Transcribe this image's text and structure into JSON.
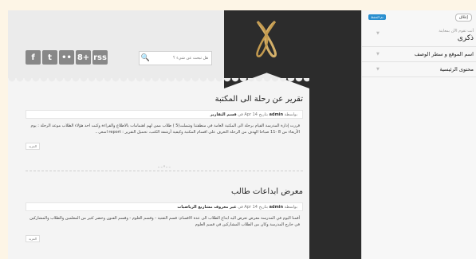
{
  "header": {
    "social_icons": [
      "f",
      "t",
      "••",
      "8+",
      "rss"
    ],
    "search_placeholder": "هل تبحث عن شيء ؟",
    "search_icon_glyph": "🔍"
  },
  "posts": [
    {
      "title": "تقرير عن رحلة الى المكتبة",
      "meta": {
        "by_label": "بواسطة",
        "author": "admin",
        "date_label": "بتاريخ 14 Apr في",
        "category": "قسم التقارير"
      },
      "excerpt": "قررت إدارة المدرسة القيام برحلة الى المكتبة العامة في منطقتنا وشملت(5 ) طلاب ممن لهم اهتمامات بالاطلاع والقراءة وكنت احد هؤلاء الطلاب موعد الرحلة : يوم الأربعاء من 8 -11 صباحا الهدف من الرحلة التعرف على اقسام المكتبة وكيفية أرشفة الكتب، تحميل التقرير : report اسعر...",
      "more_label": "المزيد"
    },
    {
      "title": "معرض ابداعات طالب",
      "meta": {
        "by_label": "بواسطة",
        "author": "admin",
        "date_label": "بتاريخ 14 Apr في",
        "category": "غير معروف مشاريع الرياضيات"
      },
      "excerpt": "أقمنا اليوم في المدرسة معرض تعرض اليه ابداع الطلاب الى عدة الاقسام: قسم التقنية - وقسم العلوم - وقسم الفنون وحضر كثير من المعلمين والطلاب والمشاركين في خارج المدرسة وكان من الطلاب المشاركين في قسم العلوم",
      "more_label": "المزيد"
    }
  ],
  "divider_glyph": "◦◦°◦◦",
  "sidebar": {
    "close_label": "إغلاق",
    "badge_label": "تم الحفظ",
    "sections": [
      {
        "hint": "أنت تقوم الآن بمعاينة",
        "value": "ذكرى"
      },
      {
        "label": "اسم الموقع و سطر الوصف"
      },
      {
        "label": "محتوى الرئيسية"
      }
    ]
  }
}
